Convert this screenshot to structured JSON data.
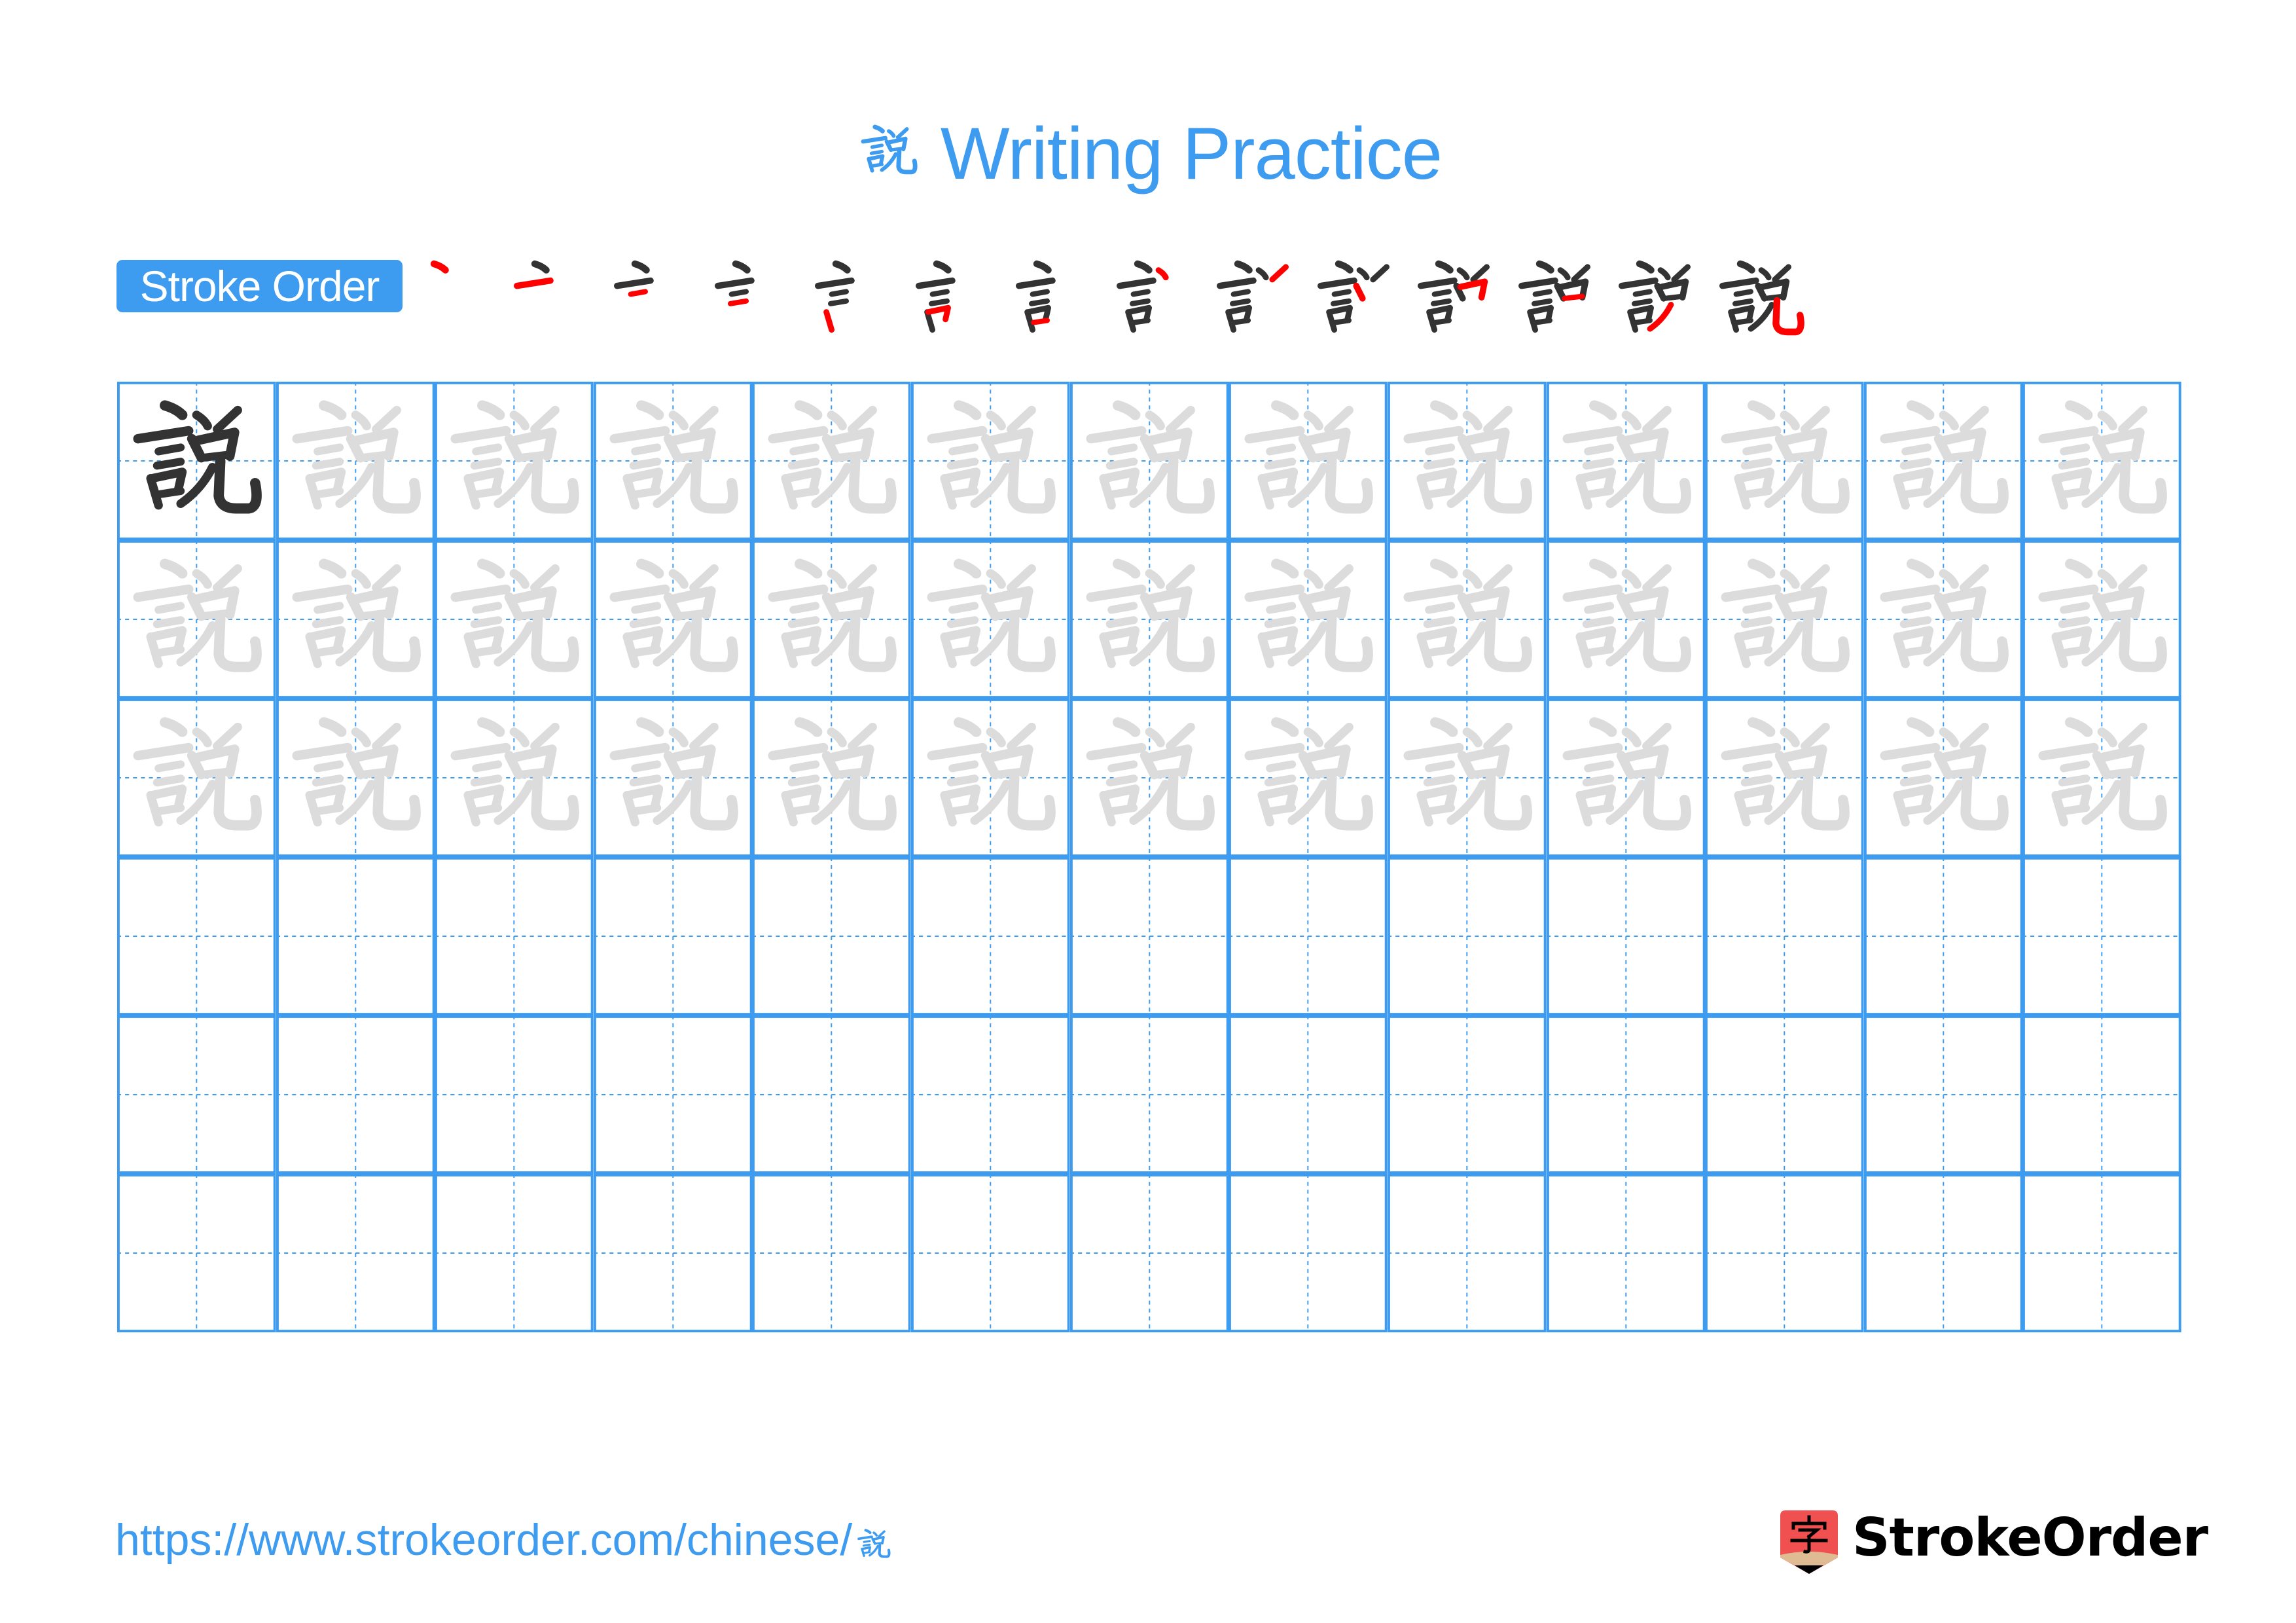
{
  "page": {
    "title_character": "說",
    "title_suffix": "Writing Practice",
    "title_full": "說 Writing Practice"
  },
  "stroke_order": {
    "label": "Stroke Order",
    "character": "說",
    "total_strokes": 14,
    "steps": [
      1,
      2,
      3,
      4,
      5,
      6,
      7,
      8,
      9,
      10,
      11,
      12,
      13,
      14
    ],
    "colors": {
      "done": "#333333",
      "current": "#ff0000"
    }
  },
  "practice_grid": {
    "character": "說",
    "columns": 13,
    "rows": 6,
    "rows_spec": [
      [
        "model",
        "ghost",
        "ghost",
        "ghost",
        "ghost",
        "ghost",
        "ghost",
        "ghost",
        "ghost",
        "ghost",
        "ghost",
        "ghost",
        "ghost"
      ],
      [
        "ghost",
        "ghost",
        "ghost",
        "ghost",
        "ghost",
        "ghost",
        "ghost",
        "ghost",
        "ghost",
        "ghost",
        "ghost",
        "ghost",
        "ghost"
      ],
      [
        "ghost",
        "ghost",
        "ghost",
        "ghost",
        "ghost",
        "ghost",
        "ghost",
        "ghost",
        "ghost",
        "ghost",
        "ghost",
        "ghost",
        "ghost"
      ],
      [
        "empty",
        "empty",
        "empty",
        "empty",
        "empty",
        "empty",
        "empty",
        "empty",
        "empty",
        "empty",
        "empty",
        "empty",
        "empty"
      ],
      [
        "empty",
        "empty",
        "empty",
        "empty",
        "empty",
        "empty",
        "empty",
        "empty",
        "empty",
        "empty",
        "empty",
        "empty",
        "empty"
      ],
      [
        "empty",
        "empty",
        "empty",
        "empty",
        "empty",
        "empty",
        "empty",
        "empty",
        "empty",
        "empty",
        "empty",
        "empty",
        "empty"
      ]
    ],
    "colors": {
      "line": "#3d9bf0",
      "model": "#333333",
      "ghost": "#dcdcdc"
    }
  },
  "footer": {
    "url_prefix": "https://www.strokeorder.com/chinese/",
    "url_character": "說",
    "url_full": "https://www.strokeorder.com/chinese/說",
    "logo_icon": "zi-character-pencil-icon",
    "logo_icon_character": "字",
    "logo_text": "StrokeOrder",
    "colors": {
      "url": "#3d9bf0",
      "logo_red": "#f05050",
      "logo_tan": "#dfbb93",
      "logo_text": "#000000"
    }
  }
}
